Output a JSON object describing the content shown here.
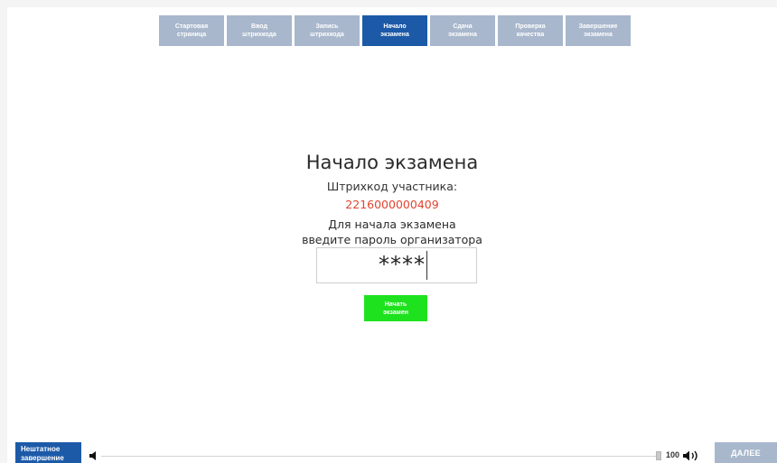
{
  "steps": [
    {
      "label": "Стартовая\nстраница",
      "active": false
    },
    {
      "label": "Ввод\nштрихкода",
      "active": false
    },
    {
      "label": "Запись\nштрихкода",
      "active": false
    },
    {
      "label": "Начало\nэкзамена",
      "active": true
    },
    {
      "label": "Сдача\nэкзамена",
      "active": false
    },
    {
      "label": "Проверка\nкачества",
      "active": false
    },
    {
      "label": "Завершение\nэкзамена",
      "active": false
    }
  ],
  "main": {
    "title": "Начало экзамена",
    "barcode_label": "Штрихкод участника:",
    "barcode_value": "2216000000409",
    "hint": "Для начала экзамена\nвведите пароль организатора",
    "password_value": "****",
    "start_button": "Начать\nэкзамен"
  },
  "footer": {
    "abort_button": "Нештатное\nзавершение",
    "volume": "100",
    "next_button": "ДАЛЕЕ"
  },
  "colors": {
    "accent": "#1c5aa8",
    "inactive_tab": "#a8b7cc",
    "barcode": "#e2442f",
    "start": "#1fe21f"
  },
  "icons": {
    "volume_mute": "speaker-left-icon",
    "volume_up": "speaker-right-icon"
  }
}
